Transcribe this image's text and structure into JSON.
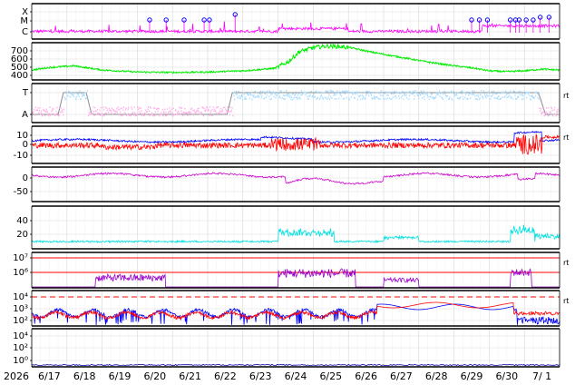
{
  "chart_data": {
    "type": "line",
    "x_axis": {
      "year_label": "2026",
      "tick_labels": [
        "6/17",
        "6/18",
        "6/19",
        "6/20",
        "6/21",
        "6/22",
        "6/23",
        "6/24",
        "6/25",
        "6/26",
        "6/27",
        "6/28",
        "6/29",
        "6/30",
        "7/ 1"
      ],
      "grid": true
    },
    "panels": [
      {
        "id": "xray",
        "y_tick_labels": [
          "X",
          "M",
          "C"
        ],
        "right_label": "",
        "series": [
          {
            "color": "#ff00ff",
            "style": "line"
          },
          {
            "color": "#0000ff",
            "style": "markers"
          }
        ],
        "flare_markers_day": [
          3.35,
          3.82,
          4.33,
          4.9,
          5.05,
          5.78,
          12.5,
          12.72,
          12.95,
          13.6,
          13.75,
          13.85,
          14.05,
          14.25,
          14.45,
          14.7
        ]
      },
      {
        "id": "speed",
        "y_tick_labels": [
          "700",
          "600",
          "500",
          "400"
        ],
        "right_label": "",
        "series": [
          {
            "color": "#00ee00",
            "profile": [
              [
                0,
                420
              ],
              [
                0.5,
                450
              ],
              [
                1.2,
                470
              ],
              [
                2,
                420
              ],
              [
                3,
                395
              ],
              [
                4,
                390
              ],
              [
                5,
                395
              ],
              [
                6,
                410
              ],
              [
                6.9,
                440
              ],
              [
                7.3,
                520
              ],
              [
                7.6,
                640
              ],
              [
                8,
                690
              ],
              [
                8.4,
                710
              ],
              [
                9,
                695
              ],
              [
                9.6,
                640
              ],
              [
                10.4,
                580
              ],
              [
                11.2,
                520
              ],
              [
                12,
                470
              ],
              [
                12.6,
                440
              ],
              [
                13,
                410
              ],
              [
                13.5,
                400
              ],
              [
                14,
                410
              ],
              [
                14.5,
                430
              ],
              [
                15,
                420
              ]
            ]
          }
        ]
      },
      {
        "id": "ta",
        "y_tick_labels": [
          "T",
          "A"
        ],
        "right_label": "rt",
        "series": [
          {
            "color": "#8a8a8a"
          },
          {
            "color": "#a8ddff"
          },
          {
            "color": "#ffb0e8"
          }
        ]
      },
      {
        "id": "bfield",
        "y_tick_labels": [
          "10",
          "0",
          "-10"
        ],
        "right_label": "rt",
        "series": [
          {
            "color": "#0000ff"
          },
          {
            "color": "#ff0000"
          }
        ]
      },
      {
        "id": "phi",
        "y_tick_labels": [
          "0",
          "-50"
        ],
        "right_label": "",
        "series": [
          {
            "color": "#cc00cc"
          }
        ]
      },
      {
        "id": "density",
        "y_tick_labels": [
          "40",
          "20"
        ],
        "right_label": "",
        "series": [
          {
            "color": "#00e0e0"
          }
        ]
      },
      {
        "id": "temperature",
        "y_tick_labels": [
          "10⁷",
          "10⁶"
        ],
        "right_label": "rt",
        "series": [
          {
            "color": "#ff0000",
            "style": "reference"
          },
          {
            "color": "#9900cc"
          }
        ]
      },
      {
        "id": "pressure",
        "y_tick_labels": [
          "10⁴",
          "10³",
          "10²"
        ],
        "right_label": "rt",
        "series": [
          {
            "color": "#0000ff"
          },
          {
            "color": "#ff0000"
          }
        ]
      },
      {
        "id": "lowest",
        "y_tick_labels": [
          "10⁴",
          "10²",
          "10⁰"
        ],
        "right_label": "",
        "series": [
          {
            "color": "#0000aa"
          }
        ]
      }
    ]
  }
}
